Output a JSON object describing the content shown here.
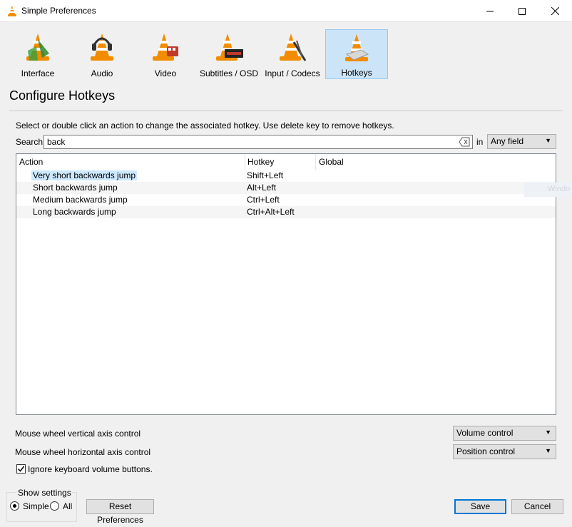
{
  "window": {
    "title": "Simple Preferences"
  },
  "toolbar": {
    "items": [
      {
        "label": "Interface"
      },
      {
        "label": "Audio"
      },
      {
        "label": "Video"
      },
      {
        "label": "Subtitles / OSD"
      },
      {
        "label": "Input / Codecs"
      },
      {
        "label": "Hotkeys",
        "selected": true
      }
    ]
  },
  "page": {
    "title": "Configure Hotkeys",
    "instructions": "Select or double click an action to change the associated hotkey. Use delete key to remove hotkeys.",
    "search_label": "Search",
    "search_value": "back",
    "in_label": "in",
    "field_filter": "Any field"
  },
  "table": {
    "columns": [
      "Action",
      "Hotkey",
      "Global"
    ],
    "rows": [
      {
        "action": "Very short backwards jump",
        "hotkey": "Shift+Left",
        "global": "",
        "selected": true
      },
      {
        "action": "Short backwards jump",
        "hotkey": "Alt+Left",
        "global": ""
      },
      {
        "action": "Medium backwards jump",
        "hotkey": "Ctrl+Left",
        "global": ""
      },
      {
        "action": "Long backwards jump",
        "hotkey": "Ctrl+Alt+Left",
        "global": ""
      }
    ]
  },
  "mouse": {
    "vertical_label": "Mouse wheel vertical axis control",
    "vertical_value": "Volume control",
    "horizontal_label": "Mouse wheel horizontal axis control",
    "horizontal_value": "Position control"
  },
  "options": {
    "ignore_volume_label": "Ignore keyboard volume buttons.",
    "ignore_volume_checked": true
  },
  "show_settings": {
    "label": "Show settings",
    "simple": "Simple",
    "all": "All",
    "selected": "Simple"
  },
  "buttons": {
    "reset": "Reset Preferences",
    "save": "Save",
    "cancel": "Cancel"
  },
  "ghost_text": "Windo",
  "colors": {
    "accent": "#0078d7",
    "selection": "#cce4f7",
    "cone_orange": "#f28c00"
  }
}
